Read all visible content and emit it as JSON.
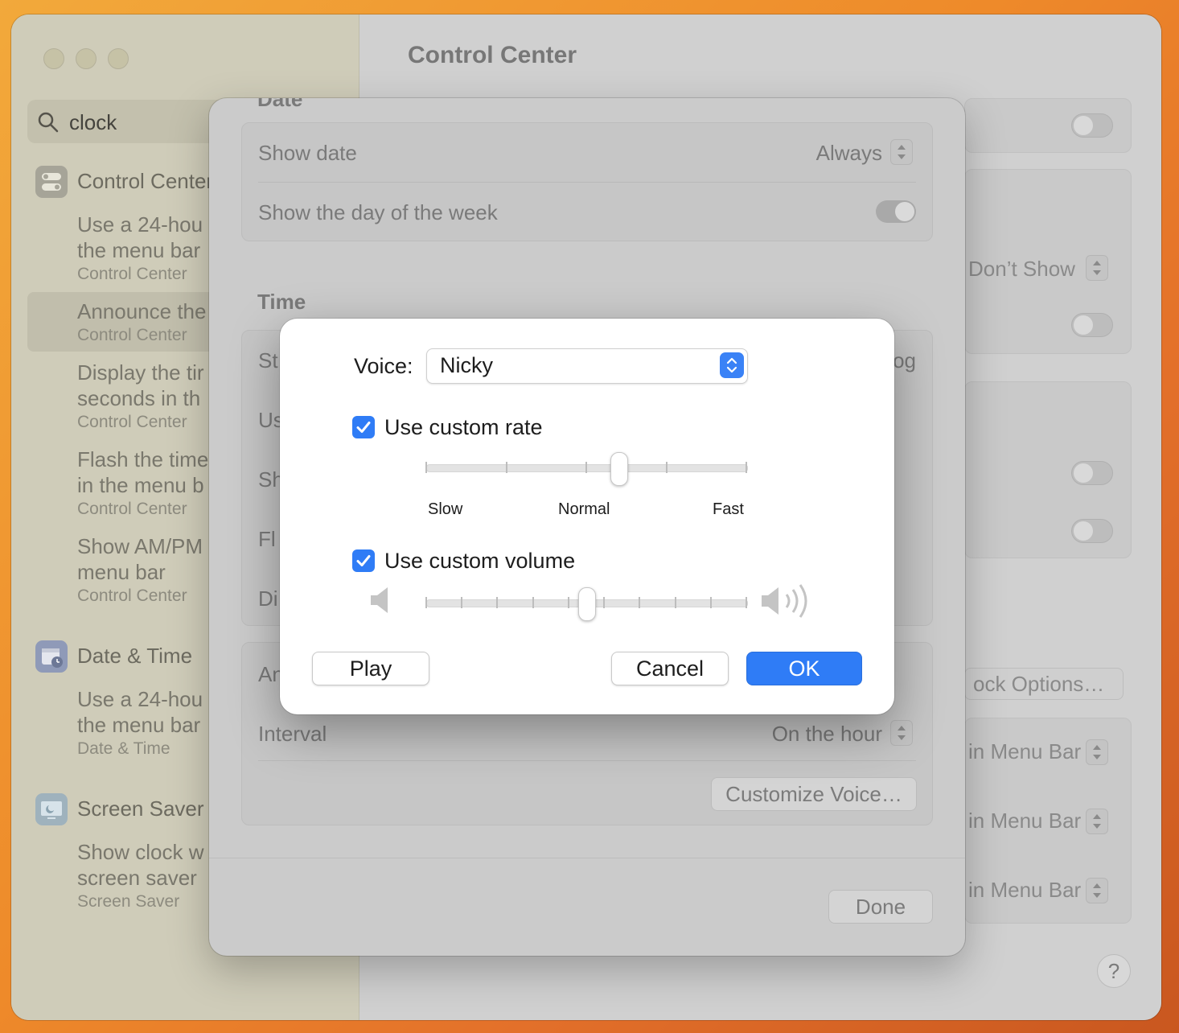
{
  "window": {
    "title": "Control Center"
  },
  "search": {
    "query": "clock"
  },
  "sidebar": {
    "groups": [
      {
        "title": "Control Center",
        "icon": "control-center-icon",
        "items": [
          {
            "line1": "Use a 24-hou",
            "line2": "the menu bar",
            "sub": "Control Center"
          },
          {
            "line1": "Announce the",
            "line2": "",
            "sub": "Control Center"
          },
          {
            "line1": "Display the tir",
            "line2": "seconds in th",
            "sub": "Control Center"
          },
          {
            "line1": "Flash the time",
            "line2": "in the menu b",
            "sub": "Control Center"
          },
          {
            "line1": "Show AM/PM",
            "line2": "menu bar",
            "sub": "Control Center"
          }
        ]
      },
      {
        "title": "Date & Time",
        "icon": "calendar-clock-icon",
        "items": [
          {
            "line1": "Use a 24-hou",
            "line2": "the menu bar",
            "sub": "Date & Time"
          }
        ]
      },
      {
        "title": "Screen Saver",
        "icon": "screen-saver-icon",
        "items": [
          {
            "line1": "Show clock w",
            "line2": "screen saver",
            "sub": "Screen Saver"
          }
        ]
      }
    ]
  },
  "background_right": {
    "dont_show": "Don’t Show",
    "clock_options": "ock Options…",
    "menu_bar_1": "in Menu Bar",
    "menu_bar_2": "in Menu Bar",
    "menu_bar_3": "in Menu Bar",
    "help": "?"
  },
  "sheet": {
    "date_section_title": "Date",
    "show_date_label": "Show date",
    "show_date_value": "Always",
    "day_of_week_label": "Show the day of the week",
    "time_section_title": "Time",
    "partial_labels": [
      "St",
      "Us",
      "Sh",
      "Fl",
      "Di",
      "An"
    ],
    "style_value_partial": "og",
    "interval_label": "Interval",
    "interval_value": "On the hour",
    "customize_voice": "Customize Voice…",
    "done": "Done"
  },
  "dialog": {
    "voice_label": "Voice:",
    "voice_value": "Nicky",
    "custom_rate_label": "Use custom rate",
    "custom_rate_checked": true,
    "rate_labels": {
      "slow": "Slow",
      "normal": "Normal",
      "fast": "Fast"
    },
    "rate_level": 0.6,
    "custom_volume_label": "Use custom volume",
    "custom_volume_checked": true,
    "volume_level": 0.5,
    "play": "Play",
    "cancel": "Cancel",
    "ok": "OK"
  },
  "colors": {
    "accent": "#2f7cf6"
  }
}
